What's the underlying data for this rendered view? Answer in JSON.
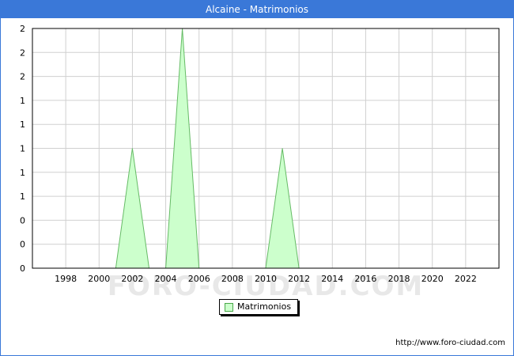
{
  "header": {
    "title": "Alcaine - Matrimonios"
  },
  "footer": {
    "source_url": "http://www.foro-ciudad.com"
  },
  "watermark": {
    "text": "FORO-CIUDAD.COM"
  },
  "colors": {
    "title_bar": "#3a78d8",
    "area_fill": "#ccffcc",
    "area_stroke": "#66bb66",
    "grid": "#d0d0d0"
  },
  "chart_data": {
    "type": "area",
    "title": "Alcaine - Matrimonios",
    "xlabel": "",
    "ylabel": "",
    "x_tick_labels": [
      "1998",
      "2000",
      "2002",
      "2004",
      "2006",
      "2008",
      "2010",
      "2012",
      "2014",
      "2016",
      "2018",
      "2020",
      "2022"
    ],
    "y_tick_labels": [
      "0",
      "0",
      "0",
      "1",
      "1",
      "1",
      "1",
      "1",
      "2",
      "2",
      "2"
    ],
    "xlim": [
      1996,
      2024
    ],
    "ylim": [
      0,
      2
    ],
    "grid": true,
    "legend_placement": "bottom-center",
    "series": [
      {
        "name": "Matrimonios",
        "x": [
          1996,
          1997,
          1998,
          1999,
          2000,
          2001,
          2002,
          2003,
          2004,
          2005,
          2006,
          2007,
          2008,
          2009,
          2010,
          2011,
          2012,
          2013,
          2014,
          2015,
          2016,
          2017,
          2018,
          2019,
          2020,
          2021,
          2022,
          2023
        ],
        "values": [
          0,
          0,
          0,
          0,
          0,
          0,
          1,
          0,
          0,
          2,
          0,
          0,
          0,
          0,
          0,
          1,
          0,
          0,
          0,
          0,
          0,
          0,
          0,
          0,
          0,
          0,
          0,
          0
        ]
      }
    ]
  }
}
